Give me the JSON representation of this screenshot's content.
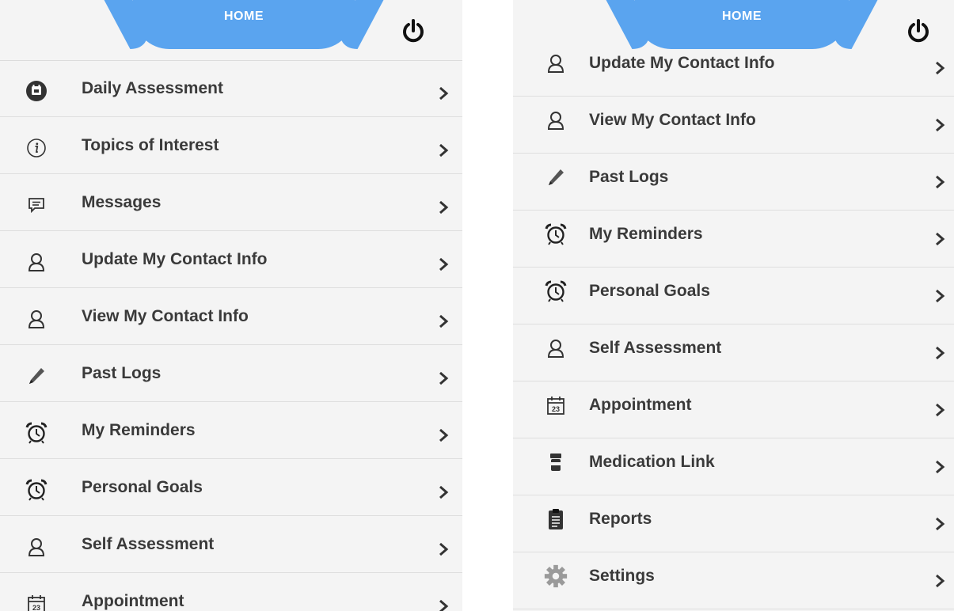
{
  "left_screen": {
    "header": {
      "title": "HOME",
      "power_icon": "power-icon"
    },
    "menu": [
      {
        "label": "Daily Assessment",
        "icon": "calendar-badge-icon"
      },
      {
        "label": "Topics of Interest",
        "icon": "info-icon"
      },
      {
        "label": "Messages",
        "icon": "message-icon"
      },
      {
        "label": "Update My Contact Info",
        "icon": "user-icon"
      },
      {
        "label": "View My Contact Info",
        "icon": "user-icon"
      },
      {
        "label": "Past Logs",
        "icon": "pencil-icon"
      },
      {
        "label": "My Reminders",
        "icon": "alarm-clock-icon"
      },
      {
        "label": "Personal Goals",
        "icon": "alarm-clock-icon"
      },
      {
        "label": "Self Assessment",
        "icon": "user-icon"
      },
      {
        "label": "Appointment",
        "icon": "calendar-23-icon"
      }
    ]
  },
  "right_screen": {
    "header": {
      "title": "HOME",
      "power_icon": "power-icon"
    },
    "menu": [
      {
        "label": "Update My Contact Info",
        "icon": "user-icon"
      },
      {
        "label": "View My Contact Info",
        "icon": "user-icon"
      },
      {
        "label": "Past Logs",
        "icon": "pencil-icon"
      },
      {
        "label": "My Reminders",
        "icon": "alarm-clock-icon"
      },
      {
        "label": "Personal Goals",
        "icon": "alarm-clock-icon"
      },
      {
        "label": "Self Assessment",
        "icon": "user-icon"
      },
      {
        "label": "Appointment",
        "icon": "calendar-23-icon"
      },
      {
        "label": "Medication Link",
        "icon": "pill-bottle-icon"
      },
      {
        "label": "Reports",
        "icon": "clipboard-icon"
      },
      {
        "label": "Settings",
        "icon": "gear-icon"
      }
    ]
  },
  "calendar_icon_number": "23",
  "colors": {
    "header_tab": "#5aa4ef",
    "background": "#f4f4f4",
    "text": "#3a3a3a",
    "divider": "#dedede"
  }
}
